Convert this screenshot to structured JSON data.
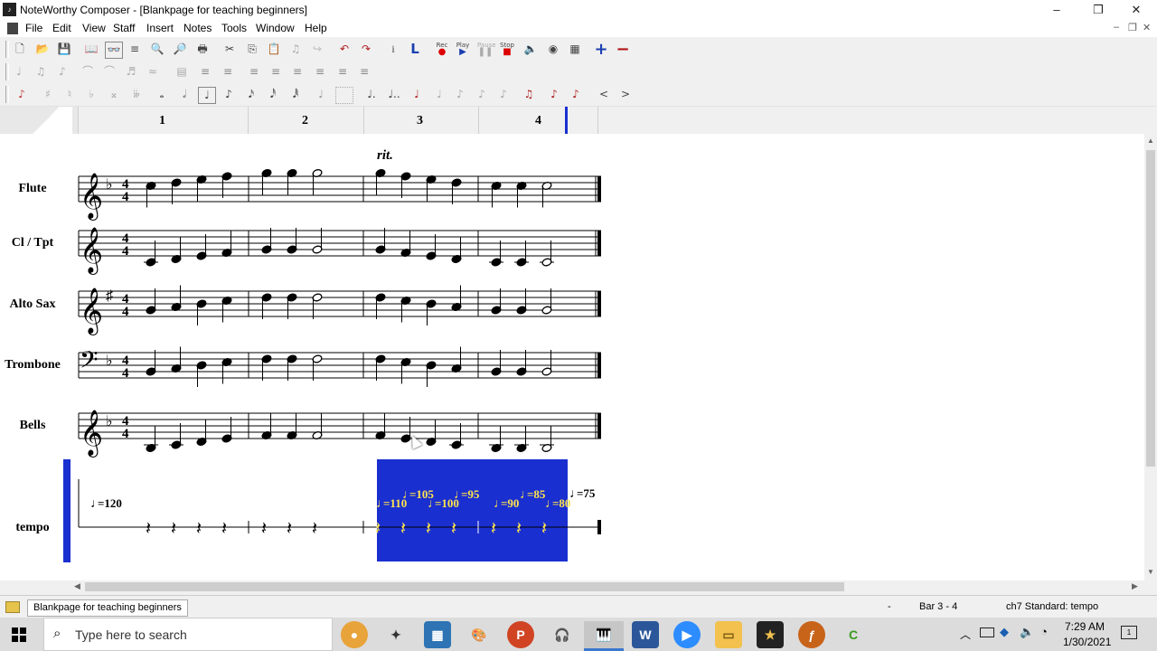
{
  "window": {
    "title": "NoteWorthy Composer - [Blankpage for teaching beginners]"
  },
  "menu": [
    "File",
    "Edit",
    "View",
    "Staff",
    "Insert",
    "Notes",
    "Tools",
    "Window",
    "Help"
  ],
  "toolbar": {
    "rec": "Rec",
    "play": "Play",
    "pause": "Pause",
    "stop": "Stop"
  },
  "ruler": {
    "bars": [
      "1",
      "2",
      "3",
      "4"
    ]
  },
  "score": {
    "direction": "rit.",
    "staves": [
      "Flute",
      "Cl / Tpt",
      "Alto Sax",
      "Trombone",
      "Bells",
      "tempo"
    ],
    "tempo_marks": [
      "=120",
      "=110",
      "=105",
      "=100",
      "=95",
      "=90",
      "=85",
      "=80",
      "=75"
    ]
  },
  "status": {
    "doc_tab": "Blankpage for teaching beginners",
    "dash": "-",
    "bar": "Bar 3 - 4",
    "staff": "ch7 Standard: tempo"
  },
  "taskbar": {
    "search_placeholder": "Type here to search",
    "time": "7:29 AM",
    "date": "1/30/2021"
  },
  "colors": {
    "selection": "#1a2fd0",
    "selection_text": "#ffe44d"
  }
}
